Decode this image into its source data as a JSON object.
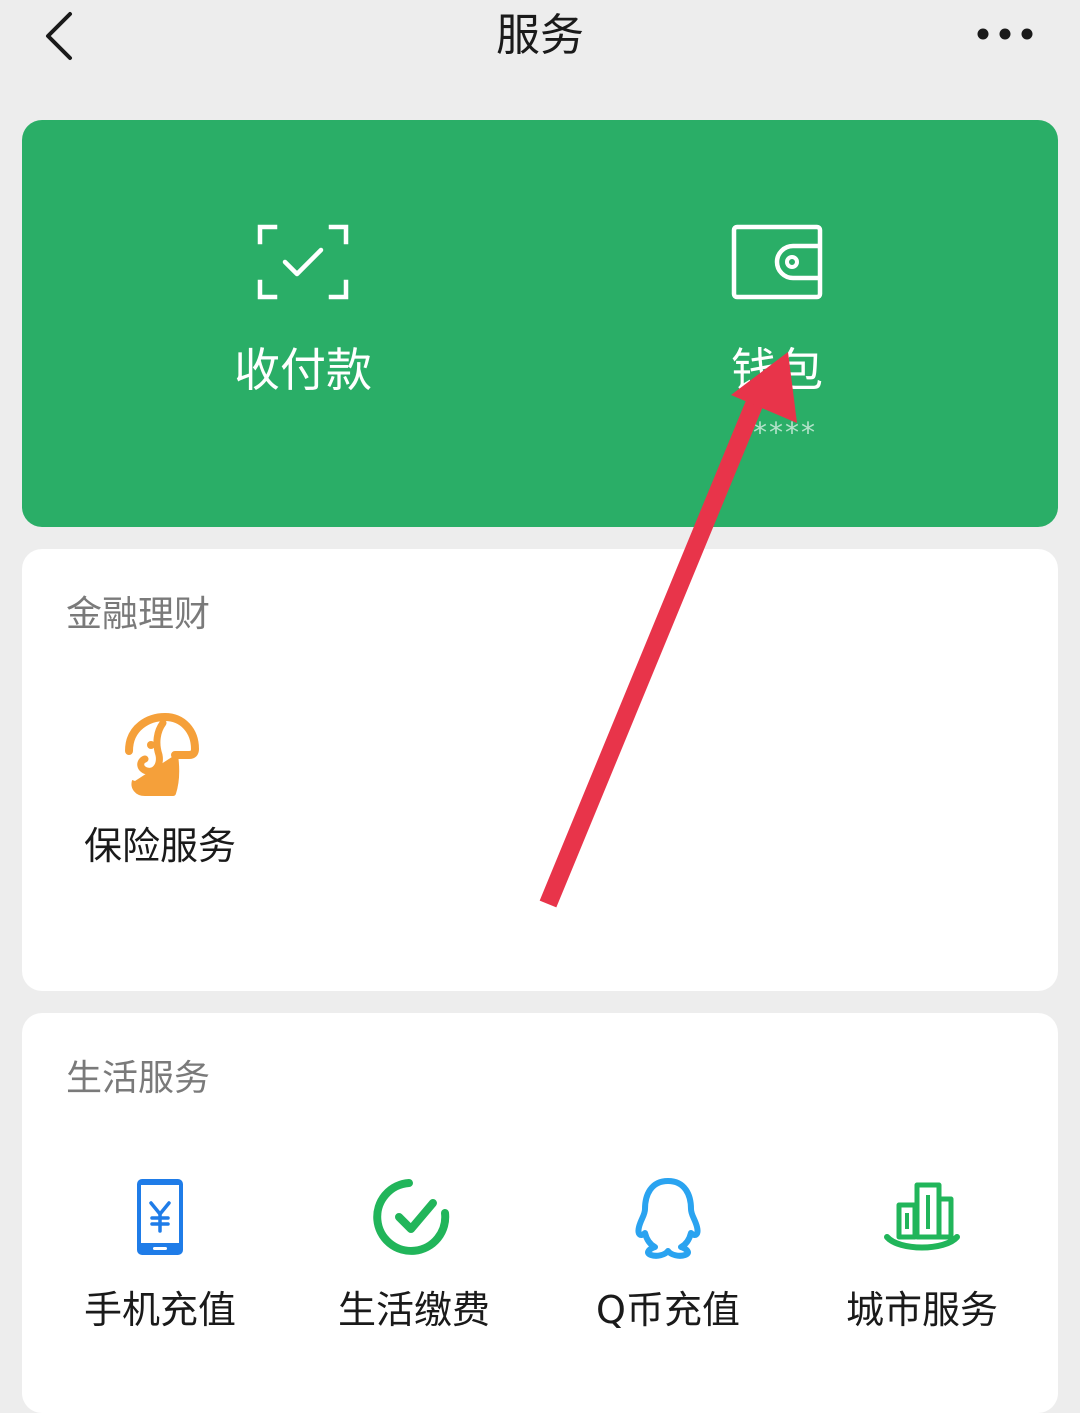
{
  "header": {
    "title": "服务",
    "back_icon": "chevron-left-icon",
    "more_icon": "more-horizontal-icon"
  },
  "primary": {
    "pay": {
      "label": "收付款",
      "icon": "scan-check-icon"
    },
    "wallet": {
      "label": "钱包",
      "sub": "*****",
      "icon": "wallet-icon"
    }
  },
  "finance": {
    "title": "金融理财",
    "items": [
      {
        "label": "保险服务",
        "icon": "insurance-umbrella-icon"
      }
    ]
  },
  "life": {
    "title": "生活服务",
    "items": [
      {
        "label": "手机充值",
        "icon": "phone-yuan-icon"
      },
      {
        "label": "生活缴费",
        "icon": "check-circle-icon"
      },
      {
        "label": "Q币充值",
        "icon": "qq-penguin-icon"
      },
      {
        "label": "城市服务",
        "icon": "city-buildings-icon"
      }
    ]
  },
  "colors": {
    "background": "#ededed",
    "primary_green": "#2aae67",
    "card": "#ffffff",
    "annotation_arrow": "#e8344a",
    "insurance_orange": "#f5a03a",
    "phone_blue": "#1f7ce8",
    "utility_green": "#21b55a",
    "qcoin_blue": "#2aa3f0",
    "city_green": "#21b55a"
  }
}
